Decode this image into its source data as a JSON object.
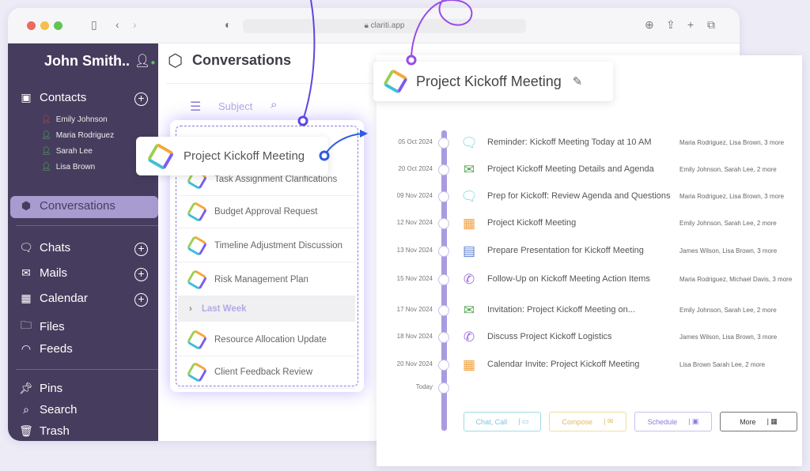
{
  "browser": {
    "url": "clariti.app"
  },
  "sidebar": {
    "user": "John Smith..",
    "contacts_label": "Contacts",
    "contacts": [
      {
        "name": "Emily Johnson",
        "color": "#d9453b"
      },
      {
        "name": "Maria Rodriguez",
        "color": "#5cc15a"
      },
      {
        "name": "Sarah Lee",
        "color": "#5cc15a"
      },
      {
        "name": "Lisa Brown",
        "color": "#5cc15a"
      }
    ],
    "conversations": "Conversations",
    "items": [
      {
        "label": "Chats",
        "icon": "chat-icon",
        "plus": true
      },
      {
        "label": "Mails",
        "icon": "mail-icon",
        "plus": true
      },
      {
        "label": "Calendar",
        "icon": "calendar-icon",
        "plus": true
      },
      {
        "label": "Files",
        "icon": "folder-icon",
        "plus": false
      },
      {
        "label": "Feeds",
        "icon": "rss-icon",
        "plus": false
      }
    ],
    "bottom": [
      {
        "label": "Pins",
        "icon": "pin-icon"
      },
      {
        "label": "Search",
        "icon": "search-icon"
      },
      {
        "label": "Trash",
        "icon": "trash-icon"
      }
    ]
  },
  "main": {
    "title": "Conversations",
    "filter_label": "Subject"
  },
  "list": {
    "floating": "Project Kickoff Meeting",
    "items": [
      "Task Assignment Clarifications",
      "Budget Approval Request",
      "Timeline Adjustment Discussion",
      "Risk Management Plan"
    ],
    "group": "Last Week",
    "items2": [
      "Resource Allocation Update",
      "Client Feedback Review"
    ]
  },
  "detail": {
    "title": "Project Kickoff Meeting",
    "rows": [
      {
        "date": "05 Oct 2024",
        "type": "chat",
        "title": "Reminder: Kickoff Meeting Today at 10 AM",
        "people": "Maria Rodriguez, Lisa Brown, 3 more"
      },
      {
        "date": "20 Oct 2024",
        "type": "mail",
        "title": "Project Kickoff Meeting Details and Agenda",
        "people": "Emily Johnson, Sarah Lee, 2 more"
      },
      {
        "date": "09 Nov 2024",
        "type": "chat",
        "title": "Prep for Kickoff: Review Agenda and Questions",
        "people": "Maria Rodriguez, Lisa Brown, 3 more"
      },
      {
        "date": "12 Nov 2024",
        "type": "event",
        "title": "Project Kickoff Meeting",
        "people": "Emily Johnson, Sarah Lee, 2 more"
      },
      {
        "date": "13 Nov 2024",
        "type": "task",
        "title": "Prepare Presentation for Kickoff Meeting",
        "people": "James Wilson, Lisa Brown, 3 more"
      },
      {
        "date": "15 Nov 2024",
        "type": "call",
        "title": "Follow-Up on Kickoff Meeting Action Items",
        "people": "Maria Rodriguez, Michael Davis, 3 more"
      },
      {
        "date": "17 Nov 2024",
        "type": "mail",
        "title": "Invitation: Project Kickoff Meeting on...",
        "people": "Emily Johnson, Sarah Lee, 2 more"
      },
      {
        "date": "18 Nov 2024",
        "type": "call",
        "title": "Discuss Project Kickoff Logistics",
        "people": "James Wilson, Lisa Brown, 3 more"
      },
      {
        "date": "20 Nov 2024",
        "type": "event",
        "title": "Calendar Invite: Project Kickoff Meeting",
        "people": "Lisa Brown Sarah Lee, 2 more"
      },
      {
        "date": "Today",
        "type": "",
        "title": "",
        "people": ""
      }
    ],
    "buttons": [
      {
        "label": "Chat, Call",
        "color": "#9fdbe8",
        "text": "#7cc6d9"
      },
      {
        "label": "Compose",
        "color": "#f0dca0",
        "text": "#e0b860"
      },
      {
        "label": "Schedule",
        "color": "#c9c0ea",
        "text": "#8b7bd8"
      },
      {
        "label": "More",
        "color": "#777777",
        "text": "#333333"
      }
    ]
  },
  "colors": {
    "sidebar": "#463d5e",
    "accent": "#8b7bd8",
    "timeline": "#a99be0"
  }
}
